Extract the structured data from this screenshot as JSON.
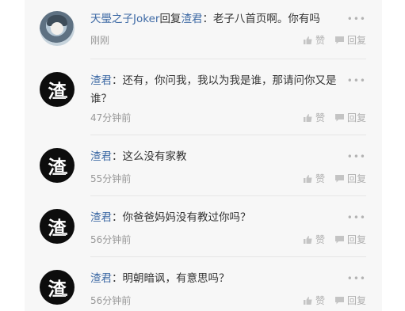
{
  "icons": {
    "like": "thumbs-up-icon",
    "reply": "chat-bubble-icon",
    "more": "more-dots-icon"
  },
  "labels": {
    "like": "赞",
    "reply": "回复",
    "more": "•••"
  },
  "comments": [
    {
      "user": "天璺之子Joker",
      "reply_word": "回复",
      "reply_to": "渣君",
      "content": "：老子八首页啊。你有吗",
      "time": "刚刚",
      "avatar": "anime-avatar"
    },
    {
      "user": "渣君",
      "content": "：还有，你问我，我以为我是谁，那请问你又是谁？",
      "time": "47分钟前",
      "avatar_text": "渣"
    },
    {
      "user": "渣君",
      "content": "：这么没有家教",
      "time": "55分钟前",
      "avatar_text": "渣"
    },
    {
      "user": "渣君",
      "content": "：你爸爸妈妈没有教过你吗？",
      "time": "56分钟前",
      "avatar_text": "渣"
    },
    {
      "user": "渣君",
      "content": "：明朝暗讽，有意思吗？",
      "time": "56分钟前",
      "avatar_text": "渣"
    }
  ]
}
